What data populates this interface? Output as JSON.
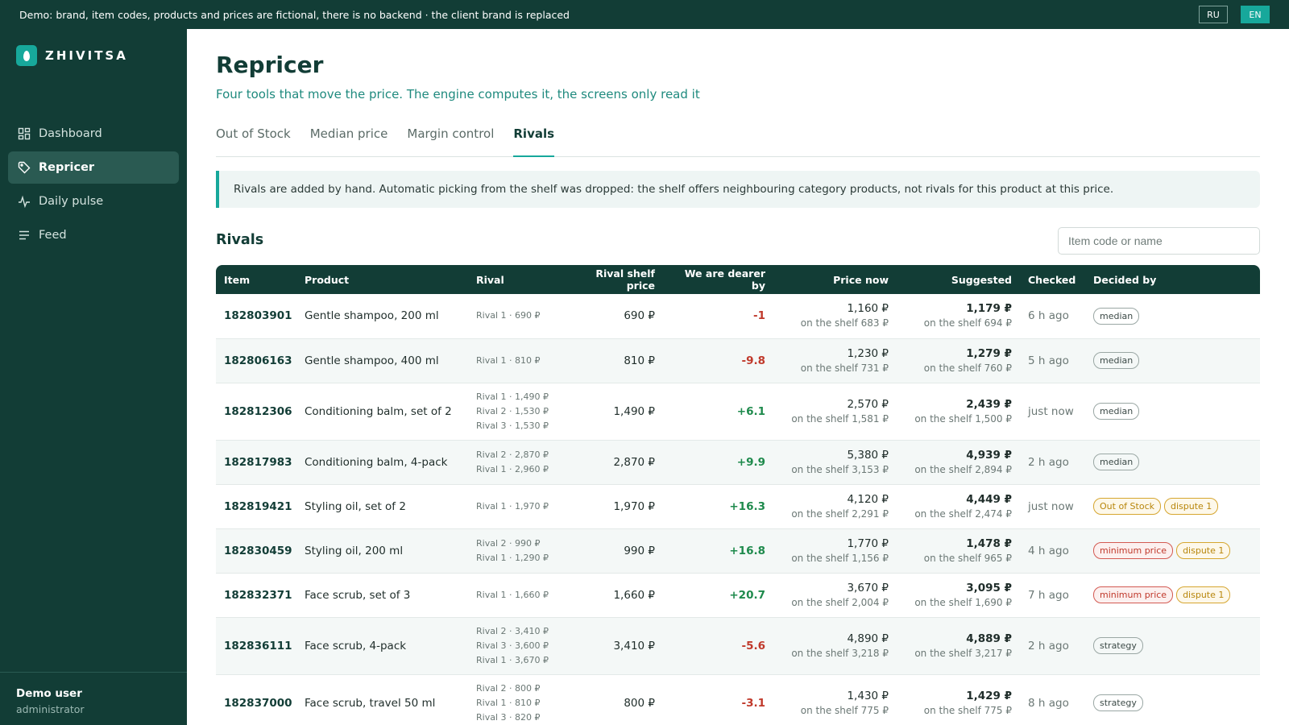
{
  "banner": {
    "text": "Demo: brand, item codes, products and prices are fictional, there is no backend · the client brand is replaced",
    "lang_ru": "RU",
    "lang_en": "EN"
  },
  "brand": "ZHIVITSA",
  "nav": [
    {
      "label": "Dashboard",
      "icon": "dashboard-icon"
    },
    {
      "label": "Repricer",
      "icon": "tag-icon"
    },
    {
      "label": "Daily pulse",
      "icon": "pulse-icon"
    },
    {
      "label": "Feed",
      "icon": "feed-icon"
    }
  ],
  "user": {
    "name": "Demo user",
    "role": "administrator"
  },
  "page": {
    "title": "Repricer",
    "subtitle": "Four tools that move the price. The engine computes it, the screens only read it"
  },
  "tabs": [
    "Out of Stock",
    "Median price",
    "Margin control",
    "Rivals"
  ],
  "note": "Rivals are added by hand. Automatic picking from the shelf was dropped: the shelf offers neighbouring category products, not rivals for this product at this price.",
  "section_title": "Rivals",
  "search": {
    "placeholder": "Item code or name",
    "value": ""
  },
  "table": {
    "headers": [
      "Item",
      "Product",
      "Rival",
      "Rival shelf price",
      "We are dearer by",
      "Price now",
      "Suggested",
      "Checked",
      "Decided by"
    ],
    "rows": [
      {
        "item": "182803901",
        "product": "Gentle shampoo, 200 ml",
        "rivals": [
          "Rival 1 · 690 ₽"
        ],
        "shelf": "690 ₽",
        "delta": "-1",
        "now": "1,160 ₽",
        "now_shelf": "on the shelf 683 ₽",
        "sugg": "1,179 ₽",
        "sugg_shelf": "on the shelf 694 ₽",
        "checked": "6 h ago",
        "badges": [
          {
            "t": "median",
            "k": "plain"
          }
        ]
      },
      {
        "item": "182806163",
        "product": "Gentle shampoo, 400 ml",
        "rivals": [
          "Rival 1 · 810 ₽"
        ],
        "shelf": "810 ₽",
        "delta": "-9.8",
        "now": "1,230 ₽",
        "now_shelf": "on the shelf 731 ₽",
        "sugg": "1,279 ₽",
        "sugg_shelf": "on the shelf 760 ₽",
        "checked": "5 h ago",
        "badges": [
          {
            "t": "median",
            "k": "plain"
          }
        ]
      },
      {
        "item": "182812306",
        "product": "Conditioning balm, set of 2",
        "rivals": [
          "Rival 1 · 1,490 ₽",
          "Rival 2 · 1,530 ₽",
          "Rival 3 · 1,530 ₽"
        ],
        "shelf": "1,490 ₽",
        "delta": "+6.1",
        "now": "2,570 ₽",
        "now_shelf": "on the shelf 1,581 ₽",
        "sugg": "2,439 ₽",
        "sugg_shelf": "on the shelf 1,500 ₽",
        "checked": "just now",
        "badges": [
          {
            "t": "median",
            "k": "plain"
          }
        ]
      },
      {
        "item": "182817983",
        "product": "Conditioning balm, 4-pack",
        "rivals": [
          "Rival 2 · 2,870 ₽",
          "Rival 1 · 2,960 ₽"
        ],
        "shelf": "2,870 ₽",
        "delta": "+9.9",
        "now": "5,380 ₽",
        "now_shelf": "on the shelf 3,153 ₽",
        "sugg": "4,939 ₽",
        "sugg_shelf": "on the shelf 2,894 ₽",
        "checked": "2 h ago",
        "badges": [
          {
            "t": "median",
            "k": "plain"
          }
        ]
      },
      {
        "item": "182819421",
        "product": "Styling oil, set of 2",
        "rivals": [
          "Rival 1 · 1,970 ₽"
        ],
        "shelf": "1,970 ₽",
        "delta": "+16.3",
        "now": "4,120 ₽",
        "now_shelf": "on the shelf 2,291 ₽",
        "sugg": "4,449 ₽",
        "sugg_shelf": "on the shelf 2,474 ₽",
        "checked": "just now",
        "badges": [
          {
            "t": "Out of Stock",
            "k": "oos"
          },
          {
            "t": "dispute 1",
            "k": "dispute"
          }
        ]
      },
      {
        "item": "182830459",
        "product": "Styling oil, 200 ml",
        "rivals": [
          "Rival 2 · 990 ₽",
          "Rival 1 · 1,290 ₽"
        ],
        "shelf": "990 ₽",
        "delta": "+16.8",
        "now": "1,770 ₽",
        "now_shelf": "on the shelf 1,156 ₽",
        "sugg": "1,478 ₽",
        "sugg_shelf": "on the shelf 965 ₽",
        "checked": "4 h ago",
        "badges": [
          {
            "t": "minimum price",
            "k": "minprice"
          },
          {
            "t": "dispute 1",
            "k": "dispute"
          }
        ]
      },
      {
        "item": "182832371",
        "product": "Face scrub, set of 3",
        "rivals": [
          "Rival 1 · 1,660 ₽"
        ],
        "shelf": "1,660 ₽",
        "delta": "+20.7",
        "now": "3,670 ₽",
        "now_shelf": "on the shelf 2,004 ₽",
        "sugg": "3,095 ₽",
        "sugg_shelf": "on the shelf 1,690 ₽",
        "checked": "7 h ago",
        "badges": [
          {
            "t": "minimum price",
            "k": "minprice"
          },
          {
            "t": "dispute 1",
            "k": "dispute"
          }
        ]
      },
      {
        "item": "182836111",
        "product": "Face scrub, 4-pack",
        "rivals": [
          "Rival 2 · 3,410 ₽",
          "Rival 3 · 3,600 ₽",
          "Rival 1 · 3,670 ₽"
        ],
        "shelf": "3,410 ₽",
        "delta": "-5.6",
        "now": "4,890 ₽",
        "now_shelf": "on the shelf 3,218 ₽",
        "sugg": "4,889 ₽",
        "sugg_shelf": "on the shelf 3,217 ₽",
        "checked": "2 h ago",
        "badges": [
          {
            "t": "strategy",
            "k": "plain"
          }
        ]
      },
      {
        "item": "182837000",
        "product": "Face scrub, travel 50 ml",
        "rivals": [
          "Rival 2 · 800 ₽",
          "Rival 1 · 810 ₽",
          "Rival 3 · 820 ₽"
        ],
        "shelf": "800 ₽",
        "delta": "-3.1",
        "now": "1,430 ₽",
        "now_shelf": "on the shelf 775 ₽",
        "sugg": "1,429 ₽",
        "sugg_shelf": "on the shelf 775 ₽",
        "checked": "8 h ago",
        "badges": [
          {
            "t": "strategy",
            "k": "plain"
          }
        ]
      }
    ]
  },
  "colors": {
    "sidebar": "#123d36",
    "accent": "#17a89b",
    "negative": "#c0392b",
    "positive": "#1e8a4c"
  }
}
